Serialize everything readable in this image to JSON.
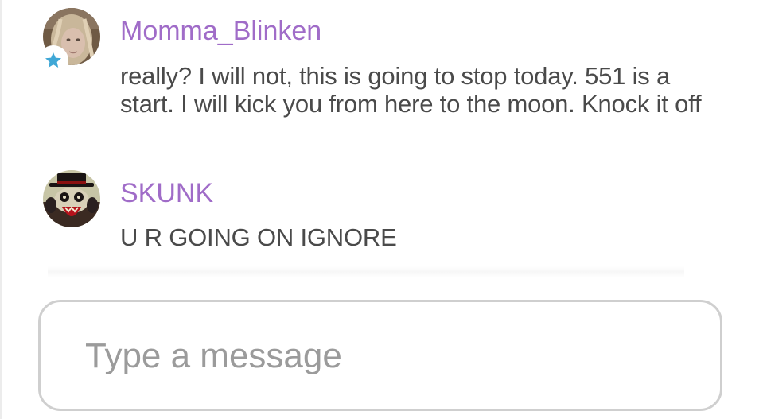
{
  "messages": [
    {
      "username": "Momma_Blinken",
      "text": "really? I will not, this is going to stop today. 551 is a start. I will kick you from here to the moon. Knock it off",
      "badge_icon": "star-icon",
      "badge_color": "#3fa7d6"
    },
    {
      "username": "SKUNK",
      "text": "U R GOING ON IGNORE"
    }
  ],
  "composer": {
    "placeholder": "Type a message"
  },
  "colors": {
    "username": "#a06cc8",
    "message_text": "#4a4a4a",
    "placeholder": "#9b9b9b",
    "composer_border": "#cfcfcf"
  }
}
